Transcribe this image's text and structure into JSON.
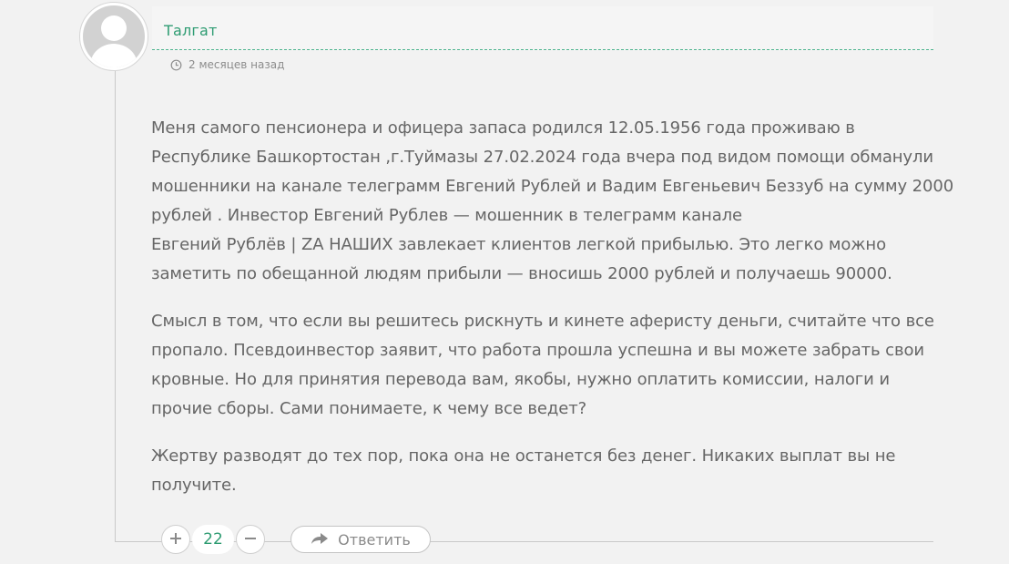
{
  "comment": {
    "author": "Талгат",
    "time_ago": "2 месяцев назад",
    "paragraphs": [
      {
        "lines": [
          "Меня самого пенсионера и офицера запаса  родился 12.05.1956 года проживаю в",
          "Республике Башкортостан ,г.Туймазы 27.02.2024 года  вчера под видом помощи обманули",
          "мошенники на канале телеграмм Евгений Рублей и Вадим Евгеньевич Беззуб на сумму 2000",
          "рублей . Инвестор Евгений Рублев — мошенник в телеграмм канале",
          "Евгений Рублёв | ZA НАШИХ завлекает клиентов легкой прибылью. Это легко можно",
          "заметить по обещанной людям прибыли — вносишь 2000 рублей и получаешь 90000."
        ]
      },
      {
        "lines": [
          "Смысл в том, что если вы решитесь рискнуть и кинете аферисту деньги, считайте что все",
          "пропало. Псевдоинвестор заявит, что работа прошла успешна и вы можете забрать свои",
          "кровные. Но для принятия перевода вам, якобы, нужно оплатить комиссии, налоги и",
          "прочие сборы. Сами понимаете, к чему все ведет?"
        ]
      },
      {
        "lines": [
          "Жертву разводят до тех пор, пока она не останется без денег. Никаких выплат вы не",
          "получите."
        ]
      }
    ],
    "vote_count": "22",
    "reply_label": "Ответить"
  },
  "icons": {
    "avatar": "user-silhouette-icon",
    "time": "clock-icon",
    "upvote": "plus-icon",
    "downvote": "minus-icon",
    "reply": "reply-arrow-icon"
  },
  "colors": {
    "accent": "#2e9c72",
    "text": "#666666",
    "meta": "#8c8c8c",
    "background": "#f2f2f2"
  }
}
